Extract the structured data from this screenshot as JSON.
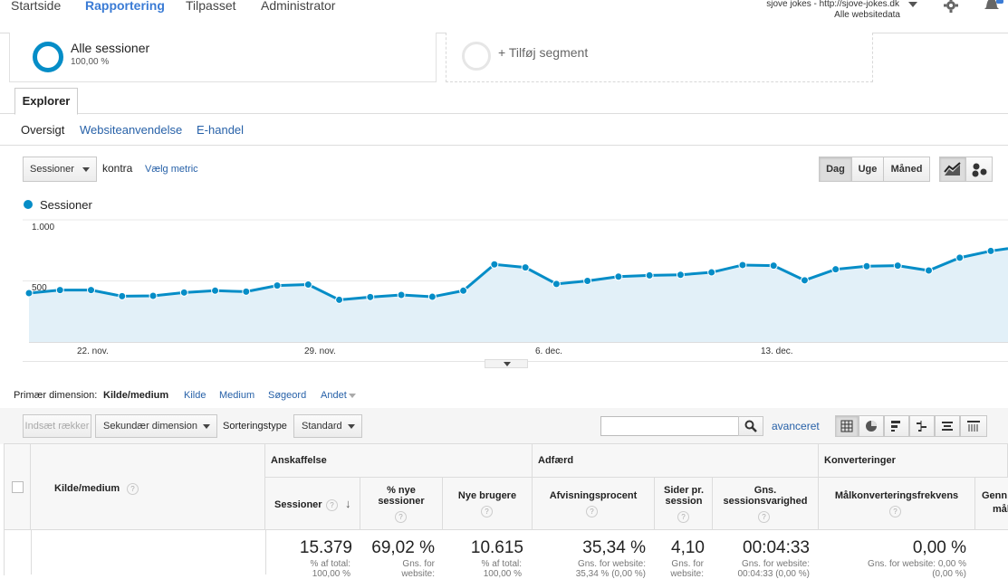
{
  "topnav": {
    "items": [
      "Startside",
      "Rapportering",
      "Tilpasset",
      "Administrator"
    ],
    "account_name": "sjove jokes - http://sjove-jokes.dk",
    "account_sub": "Alle websitedata"
  },
  "segments": {
    "active_name": "Alle sessioner",
    "active_pct": "100,00 %",
    "add_label": "+ Tilføj segment"
  },
  "explorer": {
    "tab": "Explorer",
    "subtabs": [
      "Oversigt",
      "Websiteanvendelse",
      "E-handel"
    ]
  },
  "controls": {
    "metric": "Sessioner",
    "versus": "kontra",
    "choose_metric": "Vælg metric",
    "periods": [
      "Dag",
      "Uge",
      "Måned"
    ]
  },
  "chart_data": {
    "type": "area",
    "legend": "Sessioner",
    "y_ticks": [
      "1.000",
      "500"
    ],
    "ylim": [
      0,
      1000
    ],
    "x_ticks": [
      "22. nov.",
      "29. nov.",
      "6. dec.",
      "13. dec."
    ],
    "values": [
      400,
      425,
      425,
      375,
      378,
      405,
      420,
      412,
      462,
      470,
      345,
      368,
      385,
      370,
      420,
      635,
      610,
      475,
      500,
      535,
      545,
      550,
      570,
      630,
      625,
      505,
      595,
      620,
      625,
      585,
      690,
      745
    ],
    "series_color": "#058dc7"
  },
  "dimension": {
    "label": "Primær dimension:",
    "options": [
      "Kilde/medium",
      "Kilde",
      "Medium",
      "Søgeord",
      "Andet"
    ]
  },
  "toolbar": {
    "insert_rows": "Indsæt rækker",
    "secondary": "Sekundær dimension",
    "sort_label": "Sorteringstype",
    "sort_value": "Standard",
    "search_placeholder": "",
    "advanced": "avanceret"
  },
  "table": {
    "dim_col": "Kilde/medium",
    "groups": [
      "Anskaffelse",
      "Adfærd",
      "Konverteringer"
    ],
    "cols": [
      {
        "label": "Sessioner",
        "value": "15.379",
        "sub": "% af total:",
        "sub2": "100,00 %"
      },
      {
        "label": "% nye sessioner",
        "value": "69,02 %",
        "sub": "Gns. for",
        "sub2": "website:"
      },
      {
        "label": "Nye brugere",
        "value": "10.615",
        "sub": "% af total:",
        "sub2": "100,00 %"
      },
      {
        "label": "Afvisningsprocent",
        "value": "35,34 %",
        "sub": "Gns. for website:",
        "sub2": "35,34 % (0,00 %)"
      },
      {
        "label": "Sider pr. session",
        "value": "4,10",
        "sub": "Gns. for",
        "sub2": "website:"
      },
      {
        "label": "Gns. sessionsvarighed",
        "value": "00:04:33",
        "sub": "Gns. for website:",
        "sub2": "00:04:33 (0,00 %)"
      },
      {
        "label": "Målkonverteringsfrekvens",
        "value": "0,00 %",
        "sub": "Gns. for website: 0,00 %",
        "sub2": "(0,00 %)"
      },
      {
        "label": "Genn",
        "label2": "mål",
        "value": "",
        "sub": "",
        "sub2": ""
      }
    ]
  }
}
